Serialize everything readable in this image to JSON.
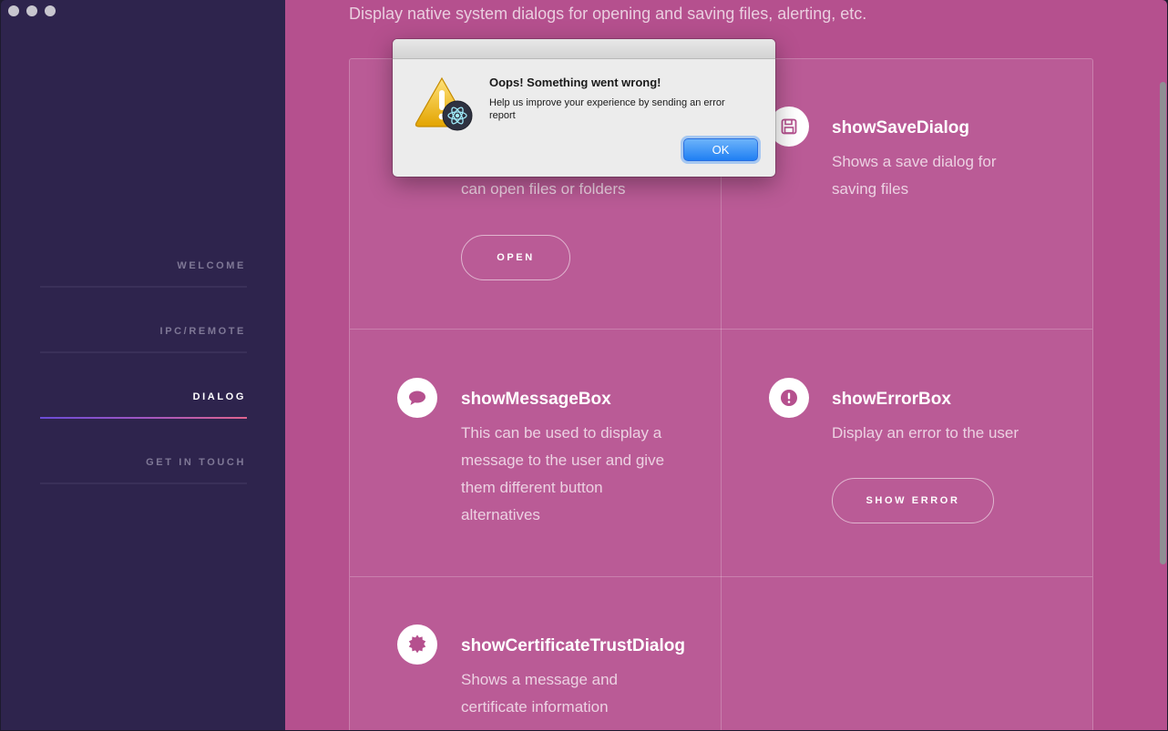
{
  "window": {
    "controls": [
      "close",
      "minimize",
      "maximize"
    ]
  },
  "sidebar": {
    "items": [
      {
        "label": "WELCOME",
        "active": false
      },
      {
        "label": "IPC/REMOTE",
        "active": false
      },
      {
        "label": "DIALOG",
        "active": true
      },
      {
        "label": "GET IN TOUCH",
        "active": false
      }
    ]
  },
  "main": {
    "subtitle": "Display native system dialogs for opening and saving files, alerting, etc.",
    "cards": {
      "open": {
        "desc_tail": "can open files or folders",
        "button": "OPEN"
      },
      "save": {
        "title": "showSaveDialog",
        "desc": "Shows a save dialog for saving files",
        "icon": "floppy-disk-icon"
      },
      "message": {
        "title": "showMessageBox",
        "desc": "This can be used to display a message to the user and give them different button alternatives",
        "icon": "speech-bubble-icon"
      },
      "error": {
        "title": "showErrorBox",
        "desc": "Display an error to the user",
        "button": "SHOW ERROR",
        "icon": "exclamation-icon"
      },
      "cert": {
        "title": "showCertificateTrustDialog",
        "desc": "Shows a message and certificate information",
        "icon": "certificate-icon"
      }
    }
  },
  "dialog": {
    "title": "Oops! Something went wrong!",
    "message": "Help us improve your experience by sending an error report",
    "ok_label": "OK",
    "icon": "warning-icon"
  },
  "colors": {
    "sidebar_bg": "#2e244d",
    "main_bg": "#b5508e",
    "card_bg": "#ba5b96",
    "accent": "#e0648e",
    "ok_button": "#1f7ff3"
  }
}
